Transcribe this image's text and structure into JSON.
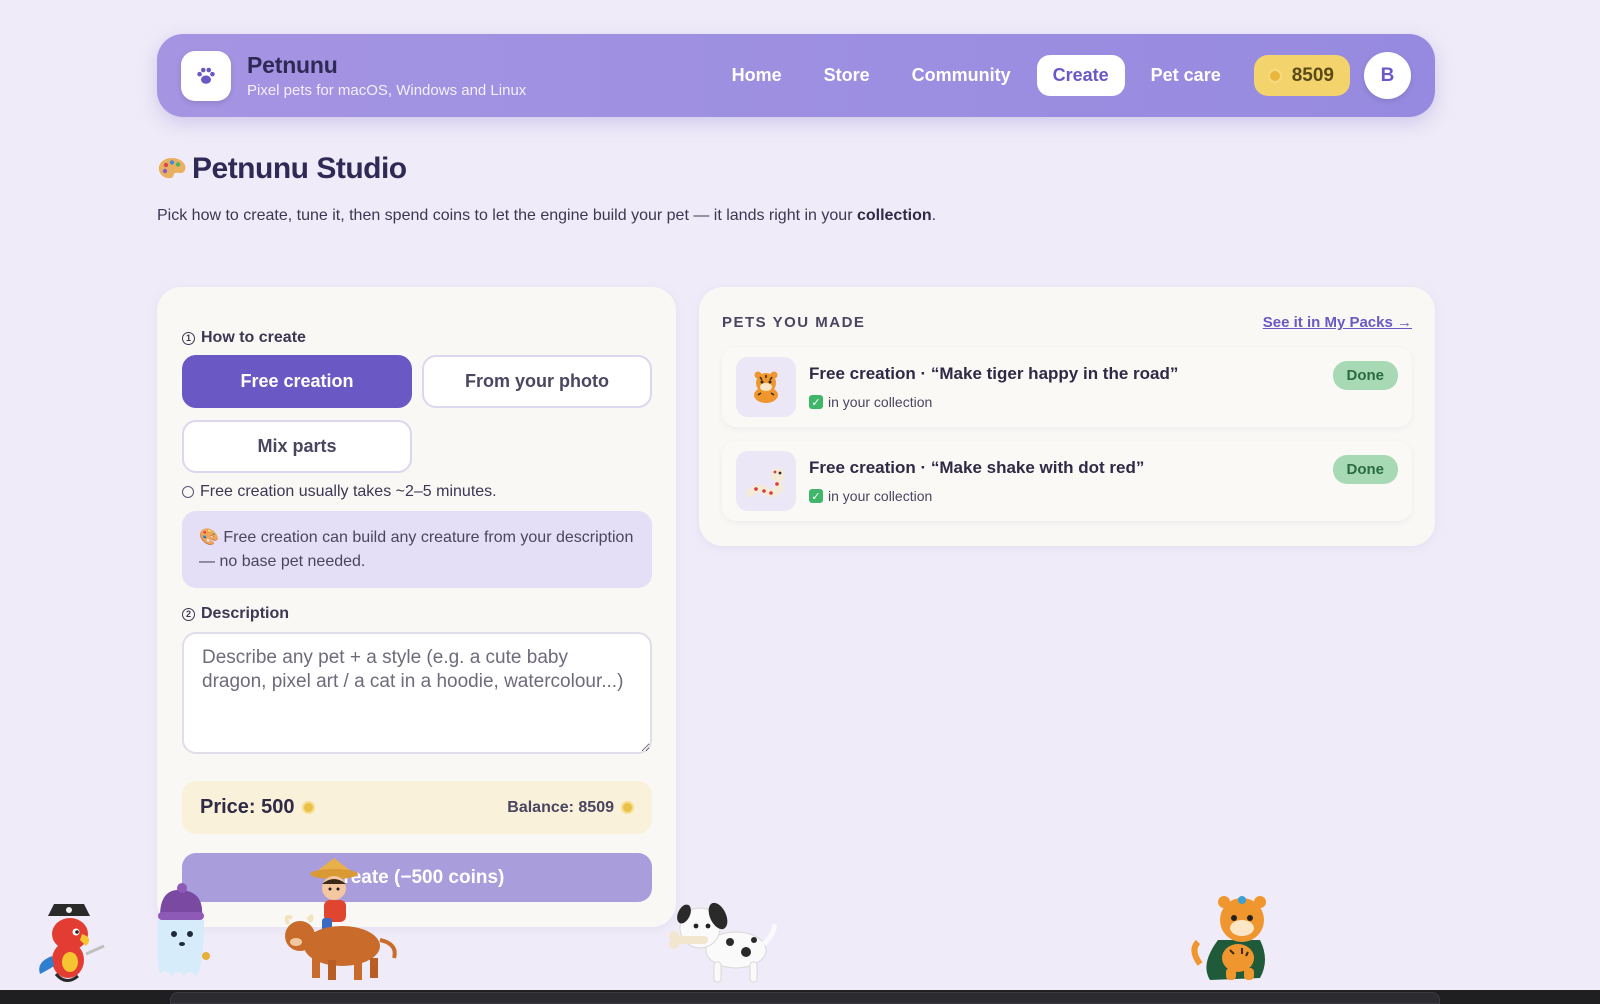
{
  "header": {
    "brand_name": "Petnunu",
    "brand_sub": "Pixel pets for macOS, Windows and Linux",
    "logo_icon": "paw-icon",
    "nav": [
      {
        "label": "Home",
        "active": false
      },
      {
        "label": "Store",
        "active": false
      },
      {
        "label": "Community",
        "active": false
      },
      {
        "label": "Create",
        "active": true
      },
      {
        "label": "Pet care",
        "active": false
      }
    ],
    "coins": "8509",
    "avatar_initial": "B"
  },
  "page": {
    "title": "Petnunu Studio",
    "title_icon": "palette-icon",
    "desc_prefix": "Pick how to create, tune it, then spend coins to let the engine build your pet — it lands right in your ",
    "desc_bold": "collection",
    "desc_suffix": "."
  },
  "create_panel": {
    "step1_num": "1",
    "step1_label": "How to create",
    "options": [
      "Free creation",
      "From your photo",
      "Mix parts"
    ],
    "selected_option": "Free creation",
    "hint": "Free creation usually takes ~2–5 minutes.",
    "info": "Free creation can build any creature from your description — no base pet needed.",
    "step2_num": "2",
    "step2_label": "Description",
    "description_placeholder": "Describe any pet + a style (e.g. a cute baby dragon, pixel art / a cat in a hoodie, watercolour...)",
    "description_value": "",
    "price_label": "Price: 500",
    "balance_label": "Balance: 8509",
    "create_button": "Create (−500 coins)"
  },
  "pets_panel": {
    "title": "PETS YOU MADE",
    "link": "See it in My Packs →",
    "pets": [
      {
        "title": "Free creation · “Make tiger happy in the road”",
        "status": "in your collection",
        "badge": "Done",
        "thumb": "tiger-thumb"
      },
      {
        "title": "Free creation · “Make shake with dot red”",
        "status": "in your collection",
        "badge": "Done",
        "thumb": "snake-thumb"
      }
    ]
  },
  "colors": {
    "accent": "#6a58c4",
    "nav_bg": "#9d8fe1",
    "coin": "#f3d36b",
    "done": "#a6d9b4",
    "background": "#efebf8"
  },
  "mascots": [
    "pirate-parrot",
    "ghost-with-beanie",
    "boy-riding-ox",
    "dalmatian-with-bone",
    "tiger-with-cape"
  ]
}
